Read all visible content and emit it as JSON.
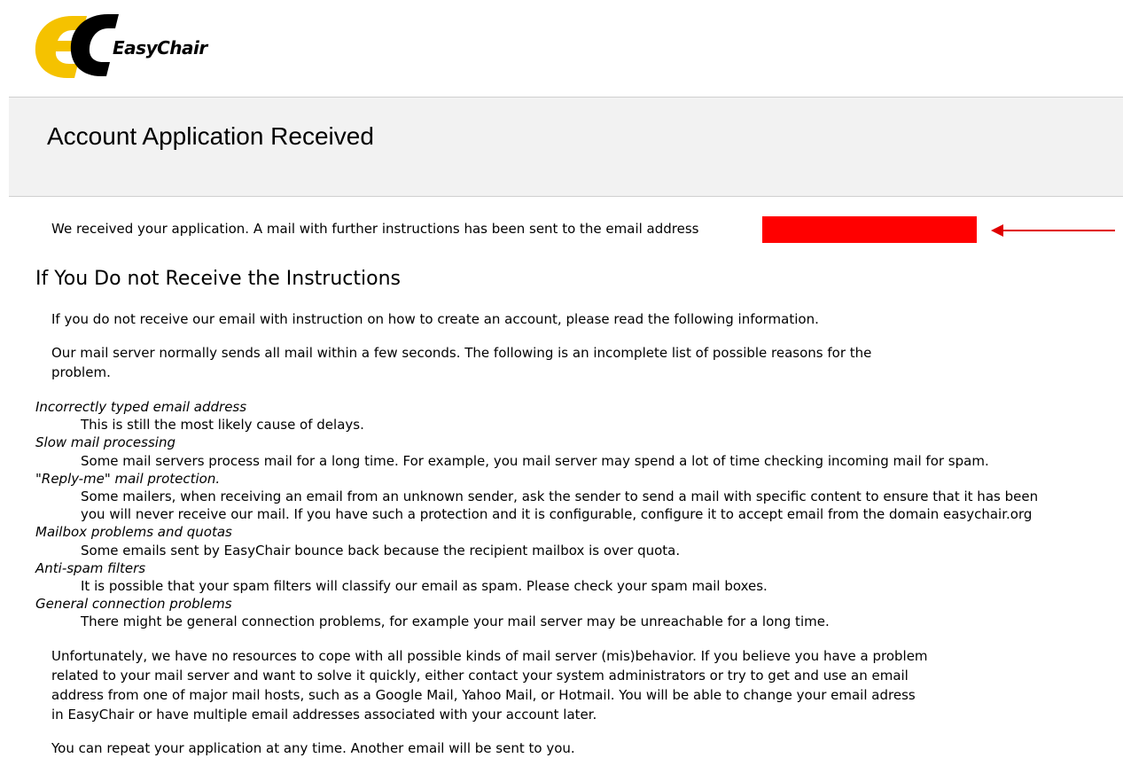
{
  "logo": {
    "text": "EasyChair"
  },
  "page_title": "Account Application Received",
  "received": {
    "text": "We received your application. A mail with further instructions has been sent to the email address"
  },
  "section_heading": "If You Do not Receive the Instructions",
  "intro_para": "If you do not receive our email with instruction on how to create an account, please read the following information.",
  "server_para_line1": "Our mail server normally sends all mail within a few seconds. The following is an incomplete list of possible reasons for the",
  "server_para_line2": "problem.",
  "reasons": [
    {
      "term": "Incorrectly typed email address",
      "desc": [
        "This is still the most likely cause of delays."
      ]
    },
    {
      "term": "Slow mail processing",
      "desc": [
        "Some mail servers process mail for a long time. For example, you mail server may spend a lot of time checking incoming mail for spam."
      ]
    },
    {
      "term": "\"Reply-me\" mail protection.",
      "desc": [
        "Some mailers, when receiving an email from an unknown sender, ask the sender to send a mail with specific content to ensure that it has been",
        "you will never receive our mail. If you have such a protection and it is configurable, configure it to accept email from the domain easychair.org"
      ]
    },
    {
      "term": "Mailbox problems and quotas",
      "desc": [
        "Some emails sent by EasyChair bounce back because the recipient mailbox is over quota."
      ]
    },
    {
      "term": "Anti-spam filters",
      "desc": [
        "It is possible that your spam filters will classify our email as spam. Please check your spam mail boxes."
      ]
    },
    {
      "term": "General connection problems",
      "desc": [
        "There might be general connection problems, for example your mail server may be unreachable for a long time."
      ]
    }
  ],
  "unfortunately_lines": [
    "Unfortunately, we have no resources to cope with all possible kinds of mail server (mis)behavior. If you believe you have a problem",
    "related to your mail server and want to solve it quickly, either contact your system administrators or try to get and use an email",
    "address from one of major mail hosts, such as a Google Mail, Yahoo Mail, or Hotmail. You will be able to change your email adress",
    "in EasyChair or have multiple email addresses associated with your account later."
  ],
  "repeat_para": "You can repeat your application at any time. Another email will be sent to you.",
  "colors": {
    "logo_yellow": "#f5c200",
    "redaction": "#ff0000",
    "arrow": "#e00000",
    "title_band": "#f2f2f2"
  },
  "icons": {
    "logo": "easychair-logo-icon",
    "arrow": "left-arrow-icon"
  }
}
